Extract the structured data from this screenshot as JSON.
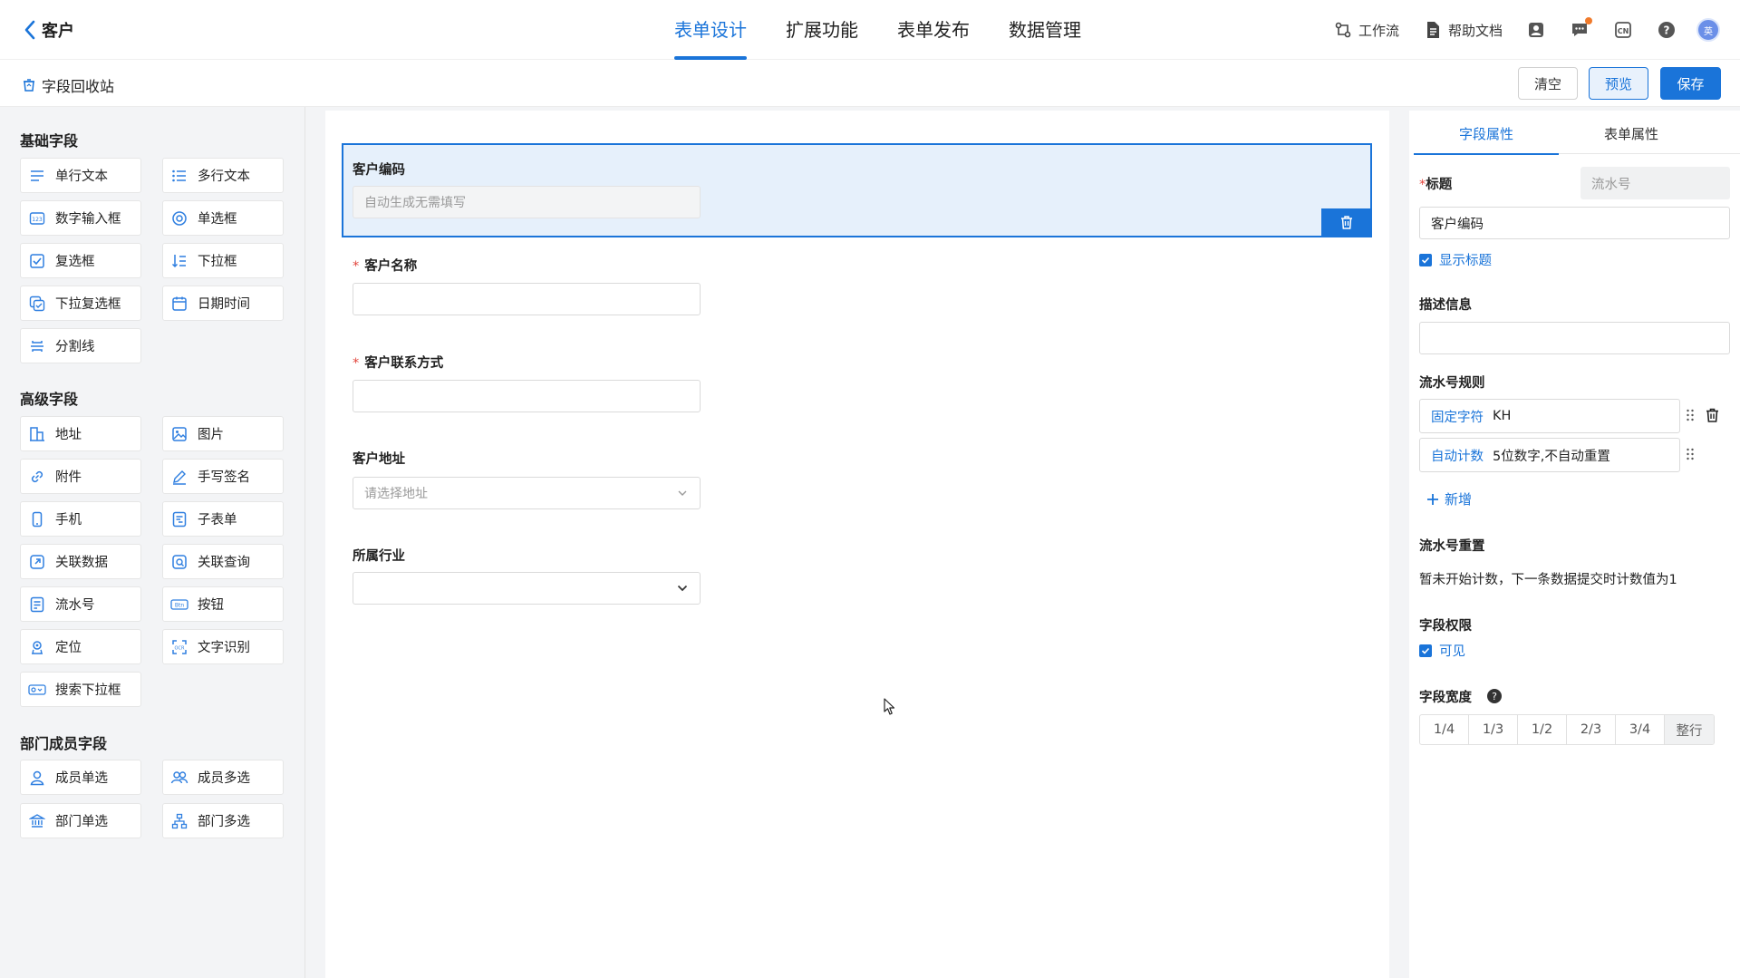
{
  "header": {
    "title": "客户",
    "tabs": [
      "表单设计",
      "扩展功能",
      "表单发布",
      "数据管理"
    ],
    "active_tab": 0,
    "tools": {
      "workflow": "工作流",
      "help_doc": "帮助文档"
    },
    "avatar_text": "英",
    "accent_color": "#1a74d9"
  },
  "subbar": {
    "recycle_label": "字段回收站",
    "clear_label": "清空",
    "preview_label": "预览",
    "save_label": "保存"
  },
  "palette": {
    "basic_title": "基础字段",
    "basic": [
      "单行文本",
      "多行文本",
      "数字输入框",
      "单选框",
      "复选框",
      "下拉框",
      "下拉复选框",
      "日期时间",
      "分割线"
    ],
    "advanced_title": "高级字段",
    "advanced": [
      "地址",
      "图片",
      "附件",
      "手写签名",
      "手机",
      "子表单",
      "关联数据",
      "关联查询",
      "流水号",
      "按钮",
      "定位",
      "文字识别",
      "搜索下拉框"
    ],
    "dept_title": "部门成员字段",
    "dept": [
      "成员单选",
      "成员多选",
      "部门单选",
      "部门多选"
    ]
  },
  "form": {
    "code": {
      "label": "客户编码",
      "placeholder": "自动生成无需填写"
    },
    "name": {
      "label": "客户名称",
      "required": "*"
    },
    "contact": {
      "label": "客户联系方式",
      "required": "*"
    },
    "address": {
      "label": "客户地址",
      "placeholder": "请选择地址"
    },
    "industry": {
      "label": "所属行业"
    }
  },
  "props": {
    "tabs": [
      "字段属性",
      "表单属性"
    ],
    "title_label": "标题",
    "title_required": "*",
    "field_type": "流水号",
    "title_value": "客户编码",
    "show_title": "显示标题",
    "desc_label": "描述信息",
    "rule_label": "流水号规则",
    "rules": [
      {
        "key": "固定字符",
        "value": "KH"
      },
      {
        "key": "自动计数",
        "value": "5位数字,不自动重置"
      }
    ],
    "add_label": "新增",
    "reset_label": "流水号重置",
    "reset_text": "暂未开始计数，下一条数据提交时计数值为1",
    "perm_label": "字段权限",
    "perm_visible": "可见",
    "width_label": "字段宽度",
    "width_options": [
      "1/4",
      "1/3",
      "1/2",
      "2/3",
      "3/4",
      "整行"
    ]
  }
}
